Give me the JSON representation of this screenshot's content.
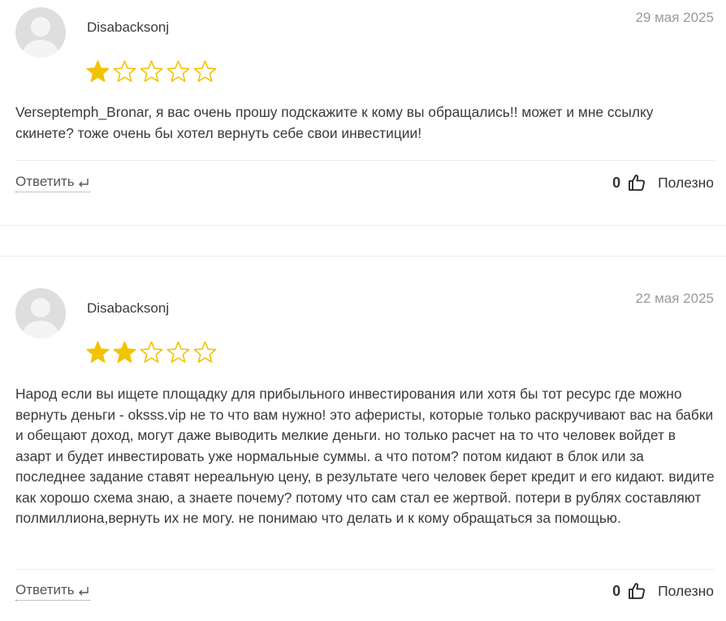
{
  "reviews": [
    {
      "author": "Disabacksonj",
      "date": "29 мая 2025",
      "rating": 1,
      "max_rating": 5,
      "text": "Verseptemph_Bronar, я вас очень прошу подскажите к кому вы обращались!! может и мне ссылку скинете? тоже очень бы хотел вернуть себе свои инвестиции!",
      "reply_label": "Ответить",
      "useful_count": "0",
      "useful_label": "Полезно"
    },
    {
      "author": "Disabacksonj",
      "date": "22 мая 2025",
      "rating": 2,
      "max_rating": 5,
      "text": "Народ если вы ищете площадку для прибыльного инвестирования или хотя бы тот ресурс где можно вернуть деньги - oksss.vip не то что вам нужно! это аферисты, которые только раскручивают вас на бабки и обещают доход, могут даже выводить мелкие деньги. но только расчет на то что человек войдет в азарт и будет инвестировать уже нормальные суммы. а что потом? потом кидают в блок или за последнее задание ставят нереальную цену, в результате чего человек берет кредит и его кидают. видите как хорошо схема знаю, а знаете почему? потому что сам стал ее жертвой. потери в рублях составляют полмиллиона,вернуть их не могу. не понимаю что делать и к кому обращаться за помощью.",
      "reply_label": "Ответить",
      "useful_count": "0",
      "useful_label": "Полезно"
    }
  ],
  "icons": {
    "avatar": "user-avatar-placeholder",
    "star_filled": "star-filled-icon",
    "star_empty": "star-outline-icon",
    "reply": "reply-arrow-icon",
    "useful": "thumbs-up-icon"
  },
  "colors": {
    "star": "#f2c300",
    "text": "#3a3a3a",
    "date": "#9a9a9a",
    "divider": "#ececec"
  }
}
